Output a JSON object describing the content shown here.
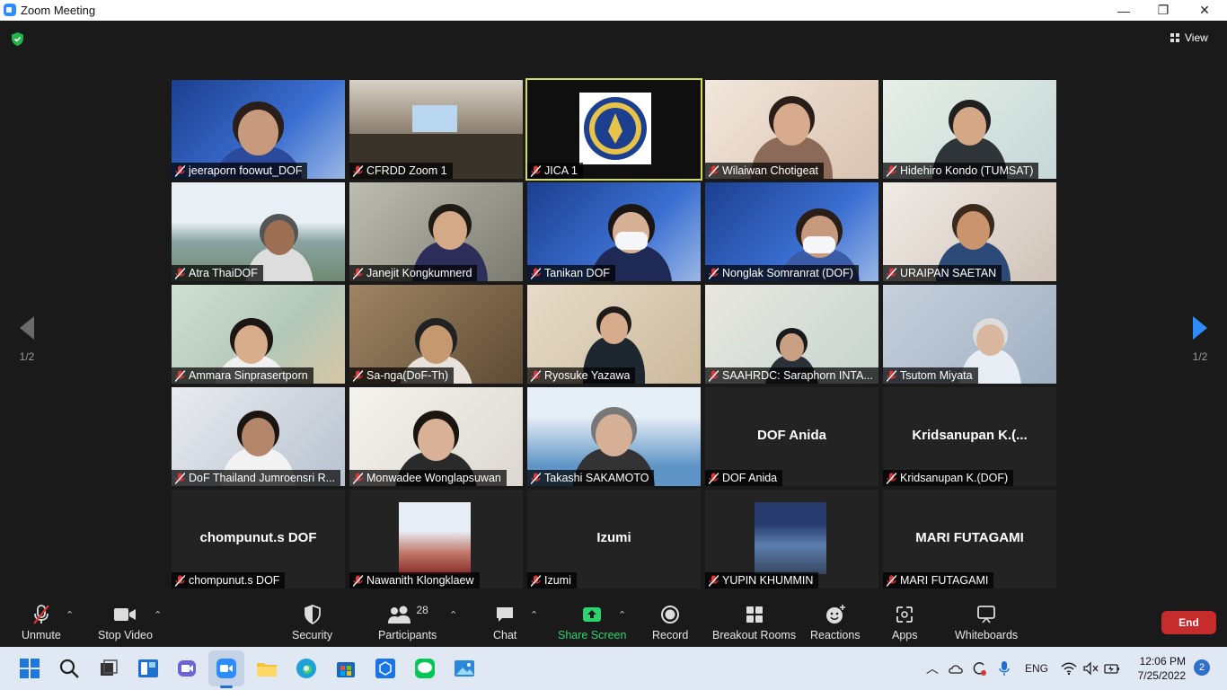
{
  "window": {
    "title": "Zoom Meeting",
    "controls": [
      "—",
      "❐",
      "✕"
    ]
  },
  "topbar": {
    "view_label": "View"
  },
  "gallery": {
    "page_indicator_left": "1/2",
    "page_indicator_right": "1/2",
    "tiles": [
      {
        "name": "jeeraporn foowut_DOF",
        "video": true
      },
      {
        "name": "CFRDD Zoom 1",
        "video": true
      },
      {
        "name": "JICA 1",
        "video": true,
        "active_speaker": true
      },
      {
        "name": "Wilaiwan Chotigeat",
        "video": true
      },
      {
        "name": "Hidehiro Kondo (TUMSAT)",
        "video": true
      },
      {
        "name": "Atra ThaiDOF",
        "video": true
      },
      {
        "name": "Janejit Kongkumnerd",
        "video": true
      },
      {
        "name": "Tanikan DOF",
        "video": true
      },
      {
        "name": "Nonglak Somranrat (DOF)",
        "video": true
      },
      {
        "name": "URAIPAN SAETAN",
        "video": true
      },
      {
        "name": "Ammara Sinprasertporn",
        "video": true
      },
      {
        "name": "Sa-nga(DoF-Th)",
        "video": true
      },
      {
        "name": "Ryosuke Yazawa",
        "video": true
      },
      {
        "name": "SAAHRDC: Saraphorn INTA...",
        "video": true
      },
      {
        "name": "Tsutom Miyata",
        "video": true
      },
      {
        "name": "DoF Thailand Jumroensri R...",
        "video": true
      },
      {
        "name": "Monwadee Wonglapsuwan",
        "video": true
      },
      {
        "name": "Takashi SAKAMOTO",
        "video": true
      },
      {
        "name": "DOF Anida",
        "video": false,
        "display_name": "DOF Anida"
      },
      {
        "name": "Kridsanupan K.(DOF)",
        "video": false,
        "display_name": "Kridsanupan  K.(..."
      },
      {
        "name": "chompunut.s DOF",
        "video": false,
        "display_name": "chompunut.s DOF"
      },
      {
        "name": "Nawanith Klongklaew",
        "video": false,
        "avatar": true
      },
      {
        "name": "Izumi",
        "video": false,
        "display_name": "Izumi"
      },
      {
        "name": "YUPIN KHUMMIN",
        "video": false,
        "avatar": true
      },
      {
        "name": "MARI FUTAGAMI",
        "video": false,
        "display_name": "MARI FUTAGAMI"
      }
    ]
  },
  "toolbar": {
    "unmute": "Unmute",
    "stop_video": "Stop Video",
    "security": "Security",
    "participants": "Participants",
    "participants_count": "28",
    "chat": "Chat",
    "share_screen": "Share Screen",
    "record": "Record",
    "breakout_rooms": "Breakout Rooms",
    "reactions": "Reactions",
    "apps": "Apps",
    "whiteboards": "Whiteboards",
    "end": "End"
  },
  "taskbar": {
    "language": "ENG",
    "time": "12:06 PM",
    "date": "7/25/2022",
    "notifications": "2"
  },
  "colors": {
    "active_border": "#d6de4a",
    "share_green": "#2dd36f",
    "end_red": "#c62c2c",
    "mute_red": "#e0363a"
  }
}
